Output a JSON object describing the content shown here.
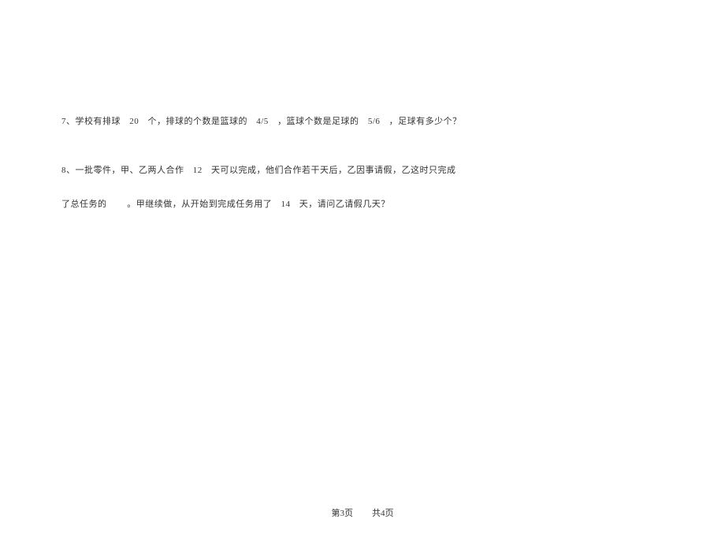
{
  "questions": {
    "q7": {
      "prefix": "7、学校有排球",
      "num1": "20",
      "mid1": "个，排球的个数是篮球的",
      "frac1": "4/5",
      "mid2": "，篮球个数是足球的",
      "frac2": "5/6",
      "suffix": "，足球有多少个？"
    },
    "q8": {
      "line1_prefix": "8、一批零件，甲、乙两人合作",
      "line1_num": "12",
      "line1_suffix": "天可以完成，他们合作若干天后，乙因事请假，乙这时只完成",
      "line2_prefix": "了总任务的",
      "line2_mid": "。甲继续做，从开始到完成任务用了",
      "line2_num": "14",
      "line2_suffix": "天，请问乙请假几天？"
    }
  },
  "footer": {
    "page_current_label": "第",
    "page_current_num": "3",
    "page_current_unit": "页",
    "page_total_label": "共",
    "page_total_num": "4",
    "page_total_unit": "页"
  }
}
